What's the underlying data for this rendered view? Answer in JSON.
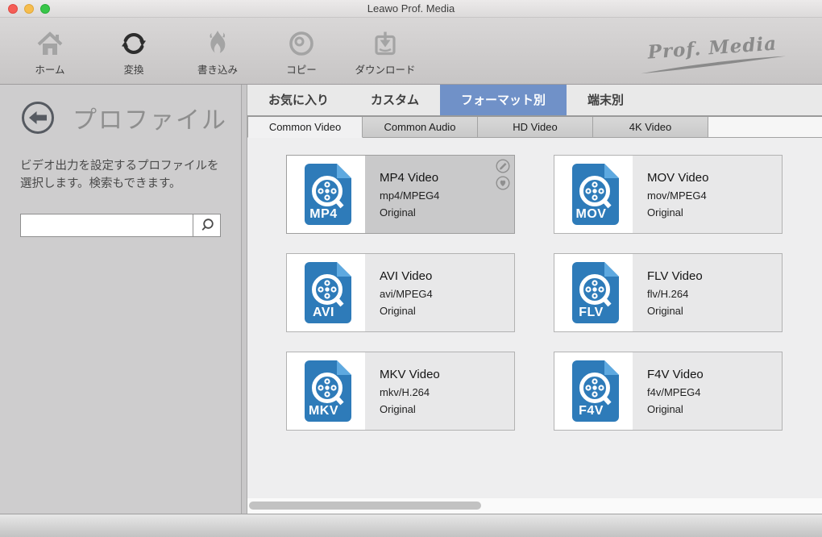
{
  "window": {
    "title": "Leawo Prof. Media"
  },
  "toolbar": {
    "logo": "Prof. Media",
    "items": [
      {
        "label": "ホーム",
        "icon": "home-icon",
        "active": false
      },
      {
        "label": "変換",
        "icon": "convert-icon",
        "active": true
      },
      {
        "label": "書き込み",
        "icon": "burn-icon",
        "active": false
      },
      {
        "label": "コピー",
        "icon": "copy-icon",
        "active": false
      },
      {
        "label": "ダウンロード",
        "icon": "download-icon",
        "active": false
      }
    ]
  },
  "sidebar": {
    "title": "プロファイル",
    "description": "ビデオ出力を設定するプロファイルを選択します。検索もできます。",
    "search_value": "",
    "search_placeholder": ""
  },
  "tabs": [
    {
      "label": "お気に入り",
      "selected": false
    },
    {
      "label": "カスタム",
      "selected": false
    },
    {
      "label": "フォーマット別",
      "selected": true
    },
    {
      "label": "端末別",
      "selected": false
    }
  ],
  "subtabs": [
    {
      "label": "Common Video",
      "selected": true
    },
    {
      "label": "Common Audio",
      "selected": false
    },
    {
      "label": "HD Video",
      "selected": false
    },
    {
      "label": "4K Video",
      "selected": false
    }
  ],
  "cards": [
    {
      "format": "MP4",
      "title": "MP4 Video",
      "codec": "mp4/MPEG4",
      "quality": "Original",
      "selected": true
    },
    {
      "format": "MOV",
      "title": "MOV Video",
      "codec": "mov/MPEG4",
      "quality": "Original",
      "selected": false
    },
    {
      "format": "AVI",
      "title": "AVI Video",
      "codec": "avi/MPEG4",
      "quality": "Original",
      "selected": false
    },
    {
      "format": "FLV",
      "title": "FLV Video",
      "codec": "flv/H.264",
      "quality": "Original",
      "selected": false
    },
    {
      "format": "MKV",
      "title": "MKV Video",
      "codec": "mkv/H.264",
      "quality": "Original",
      "selected": false
    },
    {
      "format": "F4V",
      "title": "F4V Video",
      "codec": "f4v/MPEG4",
      "quality": "Original",
      "selected": false
    }
  ],
  "colors": {
    "accent_blue": "#7091c8",
    "doc_icon_blue": "#2e7bb9",
    "doc_icon_fold_blue": "#5ea9e0",
    "selected_card_bg": "#c9c9ca",
    "card_bg": "#e8e8e9"
  }
}
